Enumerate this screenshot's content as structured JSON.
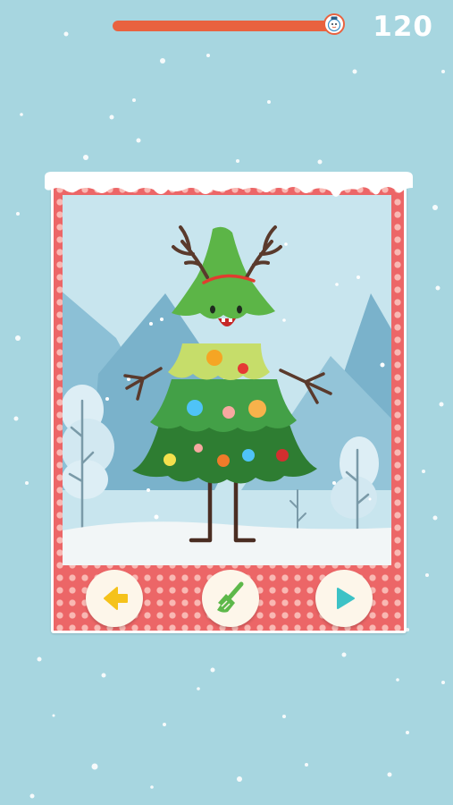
{
  "hud": {
    "score": "120",
    "progress_fraction": 0.96,
    "progress_icon": "snowman-icon"
  },
  "colors": {
    "background": "#a7d6e0",
    "progress_bar": "#e9623f",
    "frame": "#ec6667",
    "frame_dots": "#f9b8b3",
    "tree_dark": "#2e7d32",
    "tree_mid": "#43a047",
    "tree_light": "#76c043",
    "tree_pale": "#c6dd6a",
    "back_arrow": "#f5c21b",
    "play_button": "#3cc2c6",
    "broom": "#5db84a"
  },
  "controls": {
    "back_icon": "arrow-left-icon",
    "clear_icon": "broom-icon",
    "play_icon": "play-icon"
  },
  "character": {
    "type": "christmas-tree",
    "accessories": [
      "antlers",
      "red-headband"
    ]
  }
}
